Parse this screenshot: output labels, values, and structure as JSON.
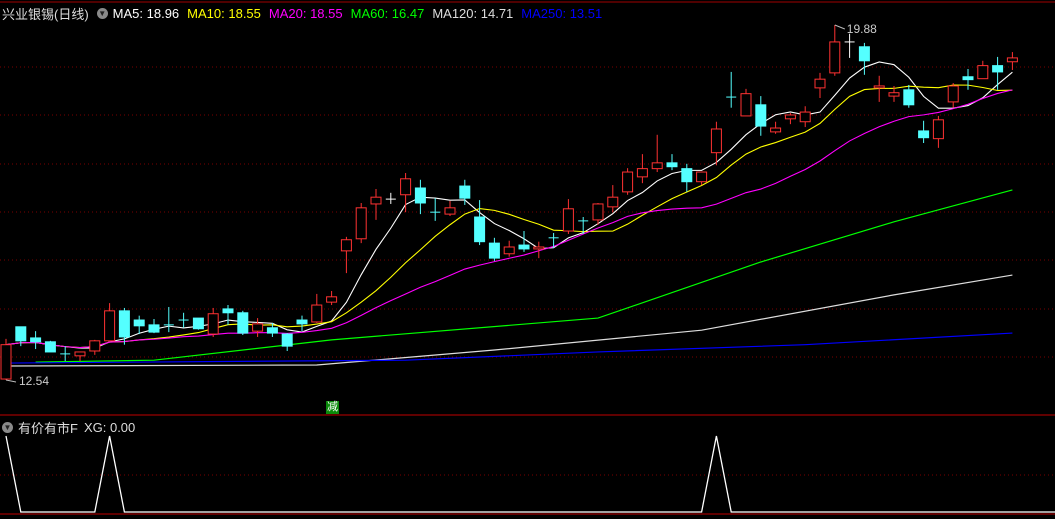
{
  "header": {
    "title": "兴业银锡(日线)",
    "ma": [
      {
        "label": "MA5: 18.96",
        "color": "#ffffff"
      },
      {
        "label": "MA10: 18.55",
        "color": "#ffff00"
      },
      {
        "label": "MA20: 18.55",
        "color": "#ff00ff"
      },
      {
        "label": "MA60: 16.47",
        "color": "#00ff00"
      },
      {
        "label": "MA120: 14.71",
        "color": "#dddddd"
      },
      {
        "label": "MA250: 13.51",
        "color": "#0000ff"
      }
    ]
  },
  "indicator": {
    "name": "有价有市F",
    "xg_label": "XG: 0.00"
  },
  "badge": "减",
  "chart_data": [
    {
      "type": "candlestick",
      "title": "兴业银锡(日线)",
      "high_label": "19.88",
      "low_label": "12.54",
      "ylim": [
        12.54,
        19.88
      ],
      "up_color": "#ff3232",
      "down_color": "#54ffff",
      "candles": [
        [
          12.56,
          13.39,
          12.54,
          13.27
        ],
        [
          13.64,
          13.64,
          13.24,
          13.35
        ],
        [
          13.41,
          13.55,
          13.18,
          13.33
        ],
        [
          13.33,
          13.35,
          13.12,
          13.12
        ],
        [
          13.08,
          13.24,
          12.93,
          13.08
        ],
        [
          13.04,
          13.12,
          12.93,
          13.12
        ],
        [
          13.14,
          13.37,
          13.06,
          13.35
        ],
        [
          13.35,
          14.13,
          13.35,
          13.97
        ],
        [
          13.97,
          14.03,
          13.27,
          13.43
        ],
        [
          13.78,
          13.87,
          13.49,
          13.66
        ],
        [
          13.68,
          13.8,
          13.51,
          13.53
        ],
        [
          13.68,
          14.05,
          13.53,
          13.68
        ],
        [
          13.78,
          13.93,
          13.62,
          13.78
        ],
        [
          13.82,
          13.82,
          13.58,
          13.6
        ],
        [
          13.49,
          14.03,
          13.43,
          13.91
        ],
        [
          14.01,
          14.09,
          13.68,
          13.93
        ],
        [
          13.93,
          13.97,
          13.47,
          13.51
        ],
        [
          13.55,
          13.82,
          13.43,
          13.7
        ],
        [
          13.62,
          13.72,
          13.43,
          13.51
        ],
        [
          13.49,
          13.51,
          13.14,
          13.24
        ],
        [
          13.78,
          13.87,
          13.55,
          13.7
        ],
        [
          13.74,
          14.32,
          13.72,
          14.09
        ],
        [
          14.15,
          14.38,
          14.09,
          14.26
        ],
        [
          15.21,
          15.5,
          14.75,
          15.44
        ],
        [
          15.46,
          16.2,
          15.37,
          16.1
        ],
        [
          16.18,
          16.49,
          15.85,
          16.32
        ],
        [
          16.28,
          16.41,
          16.18,
          16.28
        ],
        [
          16.37,
          16.82,
          16.01,
          16.7
        ],
        [
          16.51,
          16.68,
          15.97,
          16.2
        ],
        [
          16.01,
          16.3,
          15.83,
          16.01
        ],
        [
          15.97,
          16.24,
          15.93,
          16.1
        ],
        [
          16.55,
          16.68,
          16.16,
          16.3
        ],
        [
          15.91,
          16.26,
          15.33,
          15.4
        ],
        [
          15.37,
          15.48,
          15.0,
          15.06
        ],
        [
          15.15,
          15.42,
          15.09,
          15.29
        ],
        [
          15.33,
          15.62,
          15.19,
          15.25
        ],
        [
          15.25,
          15.4,
          15.06,
          15.29
        ],
        [
          15.48,
          15.58,
          15.27,
          15.48
        ],
        [
          15.62,
          16.28,
          15.56,
          16.08
        ],
        [
          15.83,
          15.91,
          15.56,
          15.83
        ],
        [
          15.85,
          16.2,
          15.75,
          16.18
        ],
        [
          16.12,
          16.57,
          16.01,
          16.32
        ],
        [
          16.43,
          16.92,
          16.37,
          16.84
        ],
        [
          16.74,
          17.21,
          16.61,
          16.91
        ],
        [
          16.91,
          17.61,
          16.84,
          17.03
        ],
        [
          17.03,
          17.21,
          16.88,
          16.95
        ],
        [
          16.91,
          17.01,
          16.43,
          16.64
        ],
        [
          16.64,
          16.84,
          16.57,
          16.84
        ],
        [
          17.24,
          17.88,
          16.98,
          17.73
        ],
        [
          18.39,
          18.91,
          18.17,
          18.39
        ],
        [
          18.0,
          18.56,
          18.0,
          18.46
        ],
        [
          18.23,
          18.41,
          17.59,
          17.79
        ],
        [
          17.67,
          17.88,
          17.63,
          17.75
        ],
        [
          17.94,
          18.06,
          17.83,
          18.02
        ],
        [
          17.88,
          18.2,
          17.77,
          18.08
        ],
        [
          18.58,
          18.89,
          18.37,
          18.76
        ],
        [
          18.89,
          19.88,
          18.83,
          19.53
        ],
        [
          19.53,
          19.7,
          19.2,
          19.53
        ],
        [
          19.43,
          19.51,
          18.85,
          19.14
        ],
        [
          18.58,
          18.83,
          18.29,
          18.62
        ],
        [
          18.41,
          18.62,
          18.29,
          18.48
        ],
        [
          18.54,
          18.64,
          18.17,
          18.23
        ],
        [
          17.69,
          17.9,
          17.44,
          17.55
        ],
        [
          17.53,
          18.0,
          17.34,
          17.92
        ],
        [
          18.29,
          18.68,
          18.17,
          18.62
        ],
        [
          18.81,
          18.97,
          18.54,
          18.75
        ],
        [
          18.77,
          19.14,
          18.77,
          19.04
        ],
        [
          19.04,
          19.22,
          18.54,
          18.91
        ],
        [
          19.12,
          19.32,
          18.95,
          19.2
        ]
      ],
      "computed_ma": [
        {
          "name": "MA5",
          "period": 5,
          "color": "#ffffff"
        },
        {
          "name": "MA10",
          "period": 10,
          "color": "#ffff00"
        },
        {
          "name": "MA20",
          "period": 20,
          "color": "#ff00ff"
        }
      ],
      "long_ma": [
        {
          "name": "MA60",
          "color": "#00ff00",
          "points": [
            [
              2,
              12.91
            ],
            [
              10,
              12.95
            ],
            [
              22,
              13.37
            ],
            [
              40,
              13.82
            ],
            [
              51,
              14.98
            ],
            [
              60,
              15.81
            ],
            [
              68,
              16.47
            ]
          ]
        },
        {
          "name": "MA120",
          "color": "#dddddd",
          "points": [
            [
              0,
              12.83
            ],
            [
              21,
              12.85
            ],
            [
              33,
              13.16
            ],
            [
              47,
              13.57
            ],
            [
              60,
              14.3
            ],
            [
              68,
              14.71
            ]
          ]
        },
        {
          "name": "MA250",
          "color": "#0000ff",
          "points": [
            [
              0,
              12.89
            ],
            [
              27,
              12.95
            ],
            [
              40,
              13.12
            ],
            [
              54,
              13.27
            ],
            [
              68,
              13.51
            ]
          ]
        }
      ]
    },
    {
      "type": "line",
      "title": "有价有市F",
      "series": [
        {
          "name": "XG",
          "color": "#ffffff",
          "peaks": [
            0,
            7,
            48
          ]
        }
      ],
      "ylim": [
        0,
        1
      ]
    }
  ]
}
